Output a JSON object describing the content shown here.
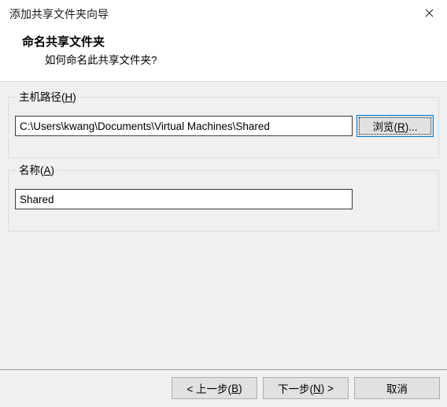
{
  "window": {
    "title": "添加共享文件夹向导",
    "close_icon": "close-icon"
  },
  "header": {
    "title": "命名共享文件夹",
    "subtitle": "如何命名此共享文件夹?"
  },
  "form": {
    "host_path": {
      "label_text": "主机路径(",
      "label_accel": "H",
      "label_tail": ")",
      "value": "C:\\Users\\kwang\\Documents\\Virtual Machines\\Shared",
      "placeholder": "",
      "browse_button": {
        "text_lead": "浏览(",
        "accel": "R",
        "text_tail": ")..."
      }
    },
    "name": {
      "label_text": "名称(",
      "label_accel": "A",
      "label_tail": ")",
      "value": "Shared",
      "placeholder": ""
    }
  },
  "footer": {
    "back_lead": "< 上一步(",
    "back_accel": "B",
    "back_tail": ")",
    "next_lead": "下一步(",
    "next_accel": "N",
    "next_tail": ") >",
    "cancel": "取消"
  },
  "colors": {
    "window_background": "#f0f0f0",
    "header_background": "#ffffff",
    "focus_accent": "#0078d7",
    "button_face": "#e1e1e1",
    "button_border": "#adadad",
    "input_border": "#3b3b3b",
    "group_border": "#dcdcdc",
    "divider": "#a0a0a0",
    "text": "#000000"
  }
}
